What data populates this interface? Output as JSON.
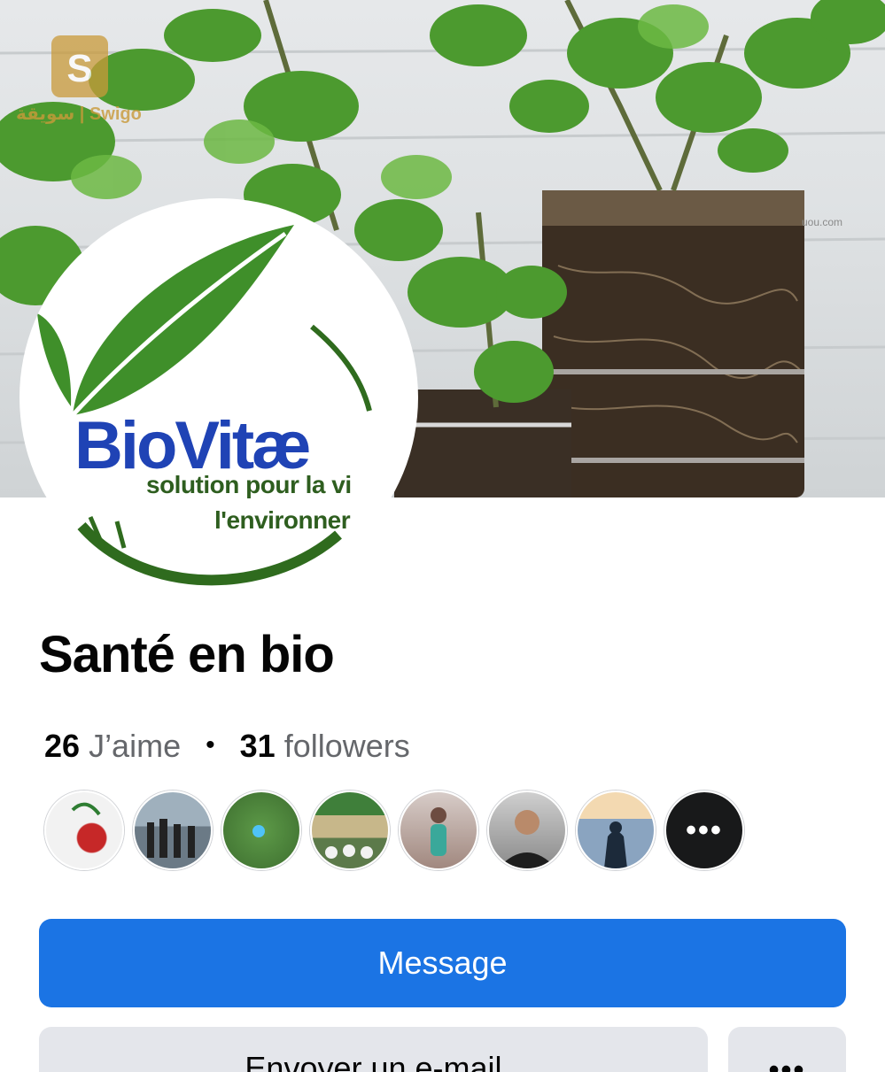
{
  "cover": {
    "watermark_text": "سويقة | Swigo",
    "site_text": "uou.com"
  },
  "logo": {
    "name": "BioVitæ",
    "tagline_line1": "solution pour la vi",
    "tagline_line2": "l'environner"
  },
  "page": {
    "title": "Santé en bio"
  },
  "stats": {
    "likes_count": "26",
    "likes_label": "J’aime",
    "followers_count": "31",
    "followers_label": "followers"
  },
  "followers": {
    "items": [
      {
        "name": "follower-rose",
        "color": "#c62828"
      },
      {
        "name": "follower-group-beach",
        "color": "#6b7a86"
      },
      {
        "name": "follower-field",
        "color": "#4a7d3a"
      },
      {
        "name": "follower-crowd",
        "color": "#5c7a4a"
      },
      {
        "name": "follower-child",
        "color": "#3aa89a"
      },
      {
        "name": "follower-man",
        "color": "#3a3a3a"
      },
      {
        "name": "follower-sunset",
        "color": "#8aa4c0"
      }
    ],
    "more_label": "•••"
  },
  "actions": {
    "message_label": "Message",
    "email_label": "Envoyer un e-mail",
    "more_label": "•••"
  },
  "colors": {
    "primary": "#1b74e4",
    "secondary_button": "#e4e6eb",
    "logo_blue": "#1f43b5",
    "logo_green": "#3f8f2a"
  }
}
